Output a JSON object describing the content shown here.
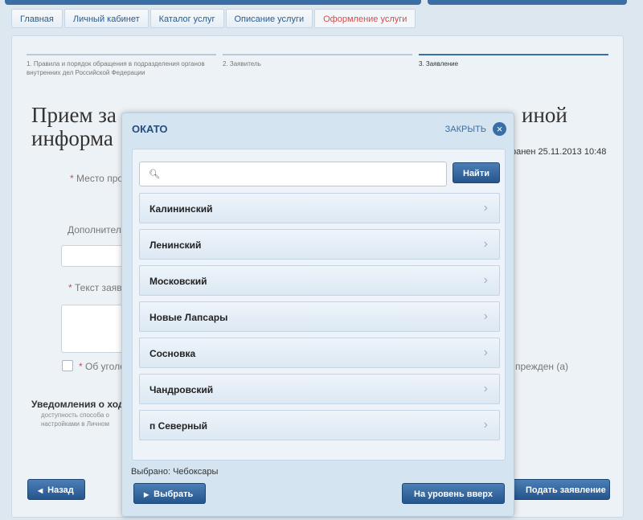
{
  "breadcrumb": [
    "Главная",
    "Личный кабинет",
    "Каталог услуг",
    "Описание услуги",
    "Оформление услуги"
  ],
  "steps": [
    "1. Правила и порядок обращения в подразделения органов внутренних дел Российской Федерации",
    "2. Заявитель",
    "3. Заявление"
  ],
  "background": {
    "title": "Прием за...                                          иной информа...",
    "title_left": "Прием за",
    "title_left2": "информа",
    "title_right": "иной",
    "saved": "ранен 25.11.2013 10:48",
    "place_label": "Место про",
    "additional_label": "Дополнител",
    "text_label": "Текст заяв",
    "check_label": "Об уголо",
    "check_label_right": "прежден (а)",
    "notice_title": "Уведомления о ход",
    "notice_text": "доступность способа о настройками в Личном",
    "back_button": "Назад",
    "submit_button": "Подать заявление"
  },
  "modal": {
    "title": "ОКАТО",
    "close_label": "ЗАКРЫТЬ",
    "search_placeholder": "",
    "find_button": "Найти",
    "items": [
      "Калининский",
      "Ленинский",
      "Московский",
      "Новые Лапсары",
      "Сосновка",
      "Чандровский",
      "п Северный"
    ],
    "selected_text": "Выбрано: Чебоксары",
    "select_button": "Выбрать",
    "up_button": "На уровень вверх"
  },
  "icons": {
    "search": "search-icon",
    "close": "close-icon",
    "chevron": "chevron-right-icon"
  },
  "colors": {
    "accent": "#3a6ea5",
    "active_breadcrumb": "#d84a4a"
  }
}
